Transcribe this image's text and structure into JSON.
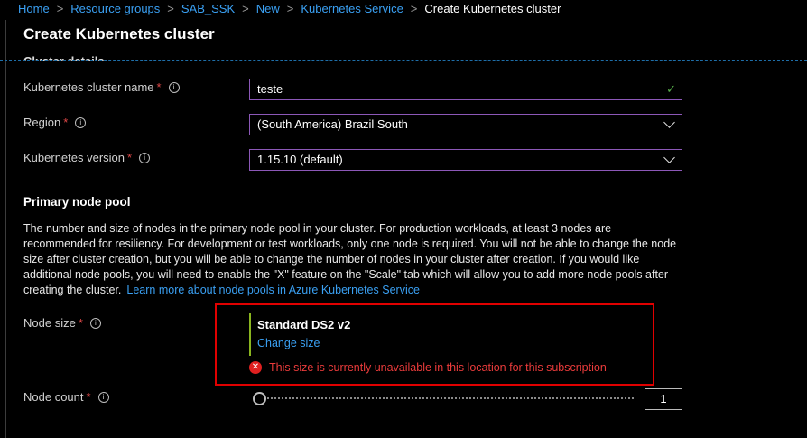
{
  "breadcrumb": [
    "Home",
    "Resource groups",
    "SAB_SSK",
    "New",
    "Kubernetes Service",
    "Create Kubernetes cluster"
  ],
  "title": "Create Kubernetes cluster",
  "section_cut": "Cluster details",
  "fields": {
    "name": {
      "label": "Kubernetes cluster name",
      "value": "teste"
    },
    "region": {
      "label": "Region",
      "value": "(South America) Brazil South"
    },
    "version": {
      "label": "Kubernetes version",
      "value": "1.15.10 (default)"
    }
  },
  "required_mark": "*",
  "info_glyph": "i",
  "node_pool": {
    "heading": "Primary node pool",
    "description": "The number and size of nodes in the primary node pool in your cluster. For production workloads, at least 3 nodes are recommended for resiliency. For development or test workloads, only one node is required. You will not be able to change the node size after cluster creation, but you will be able to change the number of nodes in your cluster after creation. If you would like additional node pools, you will need to enable the \"X\" feature on the \"Scale\" tab which will allow you to add more node pools after creating the cluster.",
    "learn_more": "Learn more about node pools in Azure Kubernetes Service"
  },
  "node_size": {
    "label": "Node size",
    "value": "Standard DS2 v2",
    "change": "Change size",
    "error": "This size is currently unavailable in this location for this subscription"
  },
  "node_count": {
    "label": "Node count",
    "value": "1",
    "slider_fraction": 0.0
  },
  "colors": {
    "link": "#3aa0f3",
    "error": "#e00000",
    "accent_purple": "#8c58b8",
    "success": "#58b04a"
  }
}
